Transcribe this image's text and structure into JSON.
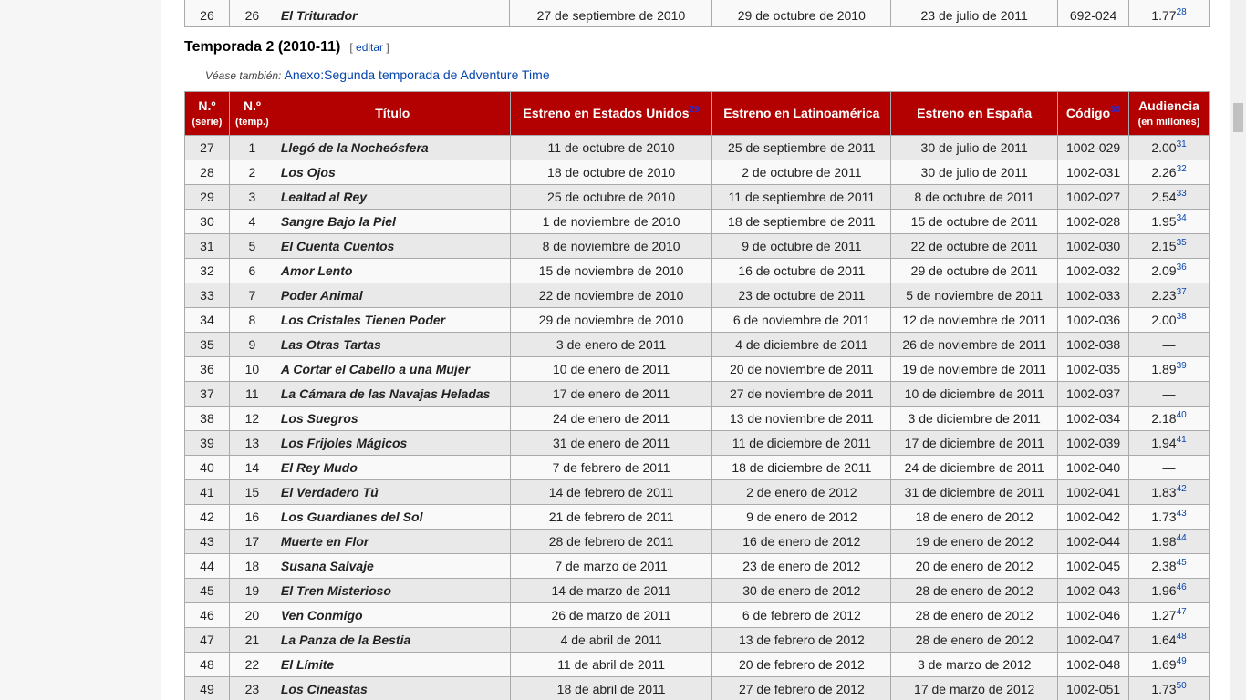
{
  "prev_row": {
    "serie": "26",
    "temp": "26",
    "title": "El Triturador",
    "us": "27 de septiembre de 2010",
    "la": "29 de octubre de 2010",
    "es": "23 de julio de 2011",
    "code": "692-024",
    "aud": "1.77",
    "ref": "28"
  },
  "section": {
    "heading": "Temporada 2 (2010-11)",
    "edit_open": "[ ",
    "edit_label": "editar",
    "edit_close": " ]",
    "see_also_label": "Véase también:",
    "see_also_link": "Anexo:Segunda temporada de Adventure Time"
  },
  "table": {
    "headers": {
      "serie": "N.º",
      "serie_sub": "(serie)",
      "temp": "N.º",
      "temp_sub": "(temp.)",
      "title": "Título",
      "us": "Estreno en Estados Unidos",
      "us_ref": "29",
      "la": "Estreno en Latinoamérica",
      "es": "Estreno en España",
      "code": "Código",
      "code_ref": "30",
      "aud": "Audiencia",
      "aud_sub": "(en millones)"
    },
    "rows": [
      {
        "serie": "27",
        "temp": "1",
        "title": "Llegó de la Nocheósfera",
        "us": "11 de octubre de 2010",
        "la": "25 de septiembre de 2011",
        "es": "30 de julio de 2011",
        "code": "1002-029",
        "aud": "2.00",
        "ref": "31"
      },
      {
        "serie": "28",
        "temp": "2",
        "title": "Los Ojos",
        "us": "18 de octubre de 2010",
        "la": "2 de octubre de 2011",
        "es": "30 de julio de 2011",
        "code": "1002-031",
        "aud": "2.26",
        "ref": "32"
      },
      {
        "serie": "29",
        "temp": "3",
        "title": "Lealtad al Rey",
        "us": "25 de octubre de 2010",
        "la": "11 de septiembre de 2011",
        "es": "8 de octubre de 2011",
        "code": "1002-027",
        "aud": "2.54",
        "ref": "33"
      },
      {
        "serie": "30",
        "temp": "4",
        "title": "Sangre Bajo la Piel",
        "us": "1 de noviembre de 2010",
        "la": "18 de septiembre de 2011",
        "es": "15 de octubre de 2011",
        "code": "1002-028",
        "aud": "1.95",
        "ref": "34"
      },
      {
        "serie": "31",
        "temp": "5",
        "title": "El Cuenta Cuentos",
        "us": "8 de noviembre de 2010",
        "la": "9 de octubre de 2011",
        "es": "22 de octubre de 2011",
        "code": "1002-030",
        "aud": "2.15",
        "ref": "35"
      },
      {
        "serie": "32",
        "temp": "6",
        "title": "Amor Lento",
        "us": "15 de noviembre de 2010",
        "la": "16 de octubre de 2011",
        "es": "29 de octubre de 2011",
        "code": "1002-032",
        "aud": "2.09",
        "ref": "36"
      },
      {
        "serie": "33",
        "temp": "7",
        "title": "Poder Animal",
        "us": "22 de noviembre de 2010",
        "la": "23 de octubre de 2011",
        "es": "5 de noviembre de 2011",
        "code": "1002-033",
        "aud": "2.23",
        "ref": "37"
      },
      {
        "serie": "34",
        "temp": "8",
        "title": "Los Cristales Tienen Poder",
        "us": "29 de noviembre de 2010",
        "la": "6 de noviembre de 2011",
        "es": "12 de noviembre de 2011",
        "code": "1002-036",
        "aud": "2.00",
        "ref": "38"
      },
      {
        "serie": "35",
        "temp": "9",
        "title": "Las Otras Tartas",
        "us": "3 de enero de 2011",
        "la": "4 de diciembre de 2011",
        "es": "26 de noviembre de 2011",
        "code": "1002-038",
        "aud": "—",
        "ref": ""
      },
      {
        "serie": "36",
        "temp": "10",
        "title": "A Cortar el Cabello a una Mujer",
        "us": "10 de enero de 2011",
        "la": "20 de noviembre de 2011",
        "es": "19 de noviembre de 2011",
        "code": "1002-035",
        "aud": "1.89",
        "ref": "39"
      },
      {
        "serie": "37",
        "temp": "11",
        "title": "La Cámara de las Navajas Heladas",
        "us": "17 de enero de 2011",
        "la": "27 de noviembre de 2011",
        "es": "10 de diciembre de 2011",
        "code": "1002-037",
        "aud": "—",
        "ref": ""
      },
      {
        "serie": "38",
        "temp": "12",
        "title": "Los Suegros",
        "us": "24 de enero de 2011",
        "la": "13 de noviembre de 2011",
        "es": "3 de diciembre de 2011",
        "code": "1002-034",
        "aud": "2.18",
        "ref": "40"
      },
      {
        "serie": "39",
        "temp": "13",
        "title": "Los Frijoles Mágicos",
        "us": "31 de enero de 2011",
        "la": "11 de diciembre de 2011",
        "es": "17 de diciembre de 2011",
        "code": "1002-039",
        "aud": "1.94",
        "ref": "41"
      },
      {
        "serie": "40",
        "temp": "14",
        "title": "El Rey Mudo",
        "us": "7 de febrero de 2011",
        "la": "18 de diciembre de 2011",
        "es": "24 de diciembre de 2011",
        "code": "1002-040",
        "aud": "—",
        "ref": ""
      },
      {
        "serie": "41",
        "temp": "15",
        "title": "El Verdadero Tú",
        "us": "14 de febrero de 2011",
        "la": "2 de enero de 2012",
        "es": "31 de diciembre de 2011",
        "code": "1002-041",
        "aud": "1.83",
        "ref": "42"
      },
      {
        "serie": "42",
        "temp": "16",
        "title": "Los Guardianes del Sol",
        "us": "21 de febrero de 2011",
        "la": "9 de enero de 2012",
        "es": "18 de enero de 2012",
        "code": "1002-042",
        "aud": "1.73",
        "ref": "43"
      },
      {
        "serie": "43",
        "temp": "17",
        "title": "Muerte en Flor",
        "us": "28 de febrero de 2011",
        "la": "16 de enero de 2012",
        "es": "19 de enero de 2012",
        "code": "1002-044",
        "aud": "1.98",
        "ref": "44"
      },
      {
        "serie": "44",
        "temp": "18",
        "title": "Susana Salvaje",
        "us": "7 de marzo de 2011",
        "la": "23 de enero de 2012",
        "es": "20 de enero de 2012",
        "code": "1002-045",
        "aud": "2.38",
        "ref": "45"
      },
      {
        "serie": "45",
        "temp": "19",
        "title": "El Tren Misterioso",
        "us": "14 de marzo de 2011",
        "la": "30 de enero de 2012",
        "es": "28 de enero de 2012",
        "code": "1002-043",
        "aud": "1.96",
        "ref": "46"
      },
      {
        "serie": "46",
        "temp": "20",
        "title": "Ven Conmigo",
        "us": "26 de marzo de 2011",
        "la": "6 de febrero de 2012",
        "es": "28 de enero de 2012",
        "code": "1002-046",
        "aud": "1.27",
        "ref": "47"
      },
      {
        "serie": "47",
        "temp": "21",
        "title": "La Panza de la Bestia",
        "us": "4 de abril de 2011",
        "la": "13 de febrero de 2012",
        "es": "28 de enero de 2012",
        "code": "1002-047",
        "aud": "1.64",
        "ref": "48"
      },
      {
        "serie": "48",
        "temp": "22",
        "title": "El Límite",
        "us": "11 de abril de 2011",
        "la": "20 de febrero de 2012",
        "es": "3 de marzo de 2012",
        "code": "1002-048",
        "aud": "1.69",
        "ref": "49"
      },
      {
        "serie": "49",
        "temp": "23",
        "title": "Los Cineastas",
        "us": "18 de abril de 2011",
        "la": "27 de febrero de 2012",
        "es": "17 de marzo de 2012",
        "code": "1002-051",
        "aud": "1.73",
        "ref": "50"
      }
    ]
  }
}
